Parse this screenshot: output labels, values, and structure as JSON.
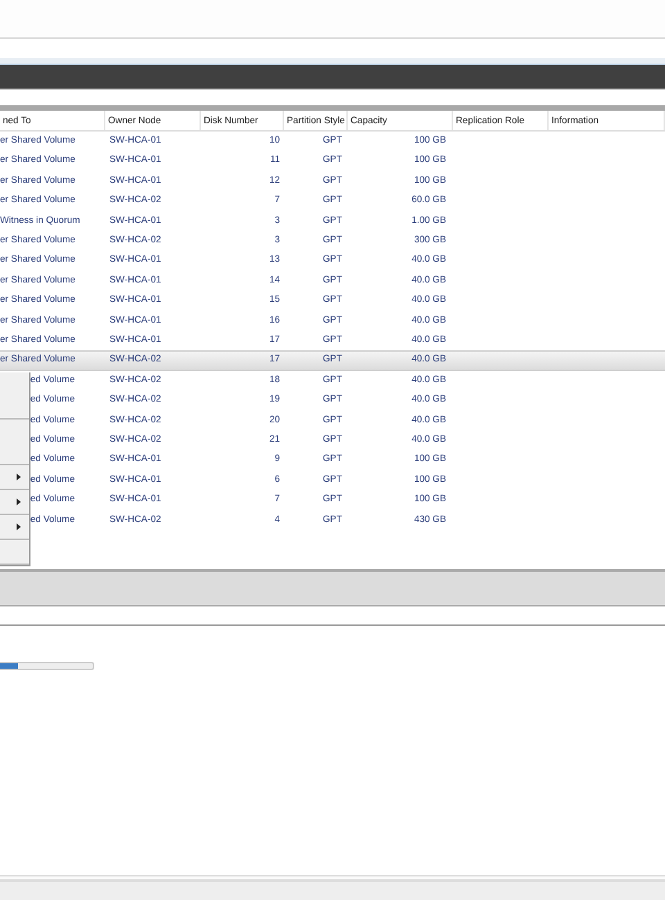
{
  "table": {
    "columns": [
      "ned To",
      "Owner Node",
      "Disk Number",
      "Partition Style",
      "Capacity",
      "Replication Role",
      "Information"
    ],
    "rows": [
      {
        "cells": [
          "er Shared Volume",
          "SW-HCA-01",
          "10",
          "GPT",
          "100 GB"
        ],
        "selected": false
      },
      {
        "cells": [
          "er Shared Volume",
          "SW-HCA-01",
          "11",
          "GPT",
          "100 GB"
        ],
        "selected": false
      },
      {
        "cells": [
          "er Shared Volume",
          "SW-HCA-01",
          "12",
          "GPT",
          "100 GB"
        ],
        "selected": false
      },
      {
        "cells": [
          "er Shared Volume",
          "SW-HCA-02",
          "7",
          "GPT",
          "60.0 GB"
        ],
        "selected": false
      },
      {
        "cells": [
          "Witness in Quorum",
          "SW-HCA-01",
          "3",
          "GPT",
          "1.00 GB"
        ],
        "selected": false
      },
      {
        "cells": [
          "er Shared Volume",
          "SW-HCA-02",
          "3",
          "GPT",
          "300 GB"
        ],
        "selected": false
      },
      {
        "cells": [
          "er Shared Volume",
          "SW-HCA-01",
          "13",
          "GPT",
          "40.0 GB"
        ],
        "selected": false
      },
      {
        "cells": [
          "er Shared Volume",
          "SW-HCA-01",
          "14",
          "GPT",
          "40.0 GB"
        ],
        "selected": false
      },
      {
        "cells": [
          "er Shared Volume",
          "SW-HCA-01",
          "15",
          "GPT",
          "40.0 GB"
        ],
        "selected": false
      },
      {
        "cells": [
          "er Shared Volume",
          "SW-HCA-01",
          "16",
          "GPT",
          "40.0 GB"
        ],
        "selected": false
      },
      {
        "cells": [
          "er Shared Volume",
          "SW-HCA-01",
          "17",
          "GPT",
          "40.0 GB"
        ],
        "selected": false
      },
      {
        "cells": [
          "er Shared Volume",
          "SW-HCA-02",
          "17",
          "GPT",
          "40.0 GB"
        ],
        "selected": true
      },
      {
        "cells": [
          "ed Volume",
          "SW-HCA-02",
          "18",
          "GPT",
          "40.0 GB"
        ],
        "selected": false
      },
      {
        "cells": [
          "ed Volume",
          "SW-HCA-02",
          "19",
          "GPT",
          "40.0 GB"
        ],
        "selected": false
      },
      {
        "cells": [
          "ed Volume",
          "SW-HCA-02",
          "20",
          "GPT",
          "40.0 GB"
        ],
        "selected": false
      },
      {
        "cells": [
          "ed Volume",
          "SW-HCA-02",
          "21",
          "GPT",
          "40.0 GB"
        ],
        "selected": false
      },
      {
        "cells": [
          "ed Volume",
          "SW-HCA-01",
          "9",
          "GPT",
          "100 GB"
        ],
        "selected": false
      },
      {
        "cells": [
          "ed Volume",
          "SW-HCA-01",
          "6",
          "GPT",
          "100 GB"
        ],
        "selected": false
      },
      {
        "cells": [
          "ed Volume",
          "SW-HCA-01",
          "7",
          "GPT",
          "100 GB"
        ],
        "selected": false
      },
      {
        "cells": [
          "ed Volume",
          "SW-HCA-02",
          "4",
          "GPT",
          "430 GB"
        ],
        "selected": false
      }
    ]
  },
  "context_menu": {
    "items": [
      {
        "kind": "item"
      },
      {
        "kind": "item"
      },
      {
        "kind": "separator"
      },
      {
        "kind": "item"
      },
      {
        "kind": "item"
      },
      {
        "kind": "separator"
      },
      {
        "kind": "submenu"
      },
      {
        "kind": "separator"
      },
      {
        "kind": "submenu"
      },
      {
        "kind": "separator"
      },
      {
        "kind": "submenu"
      },
      {
        "kind": "separator"
      },
      {
        "kind": "item"
      },
      {
        "kind": "separator"
      }
    ]
  },
  "progress": {
    "level": 0.2
  }
}
